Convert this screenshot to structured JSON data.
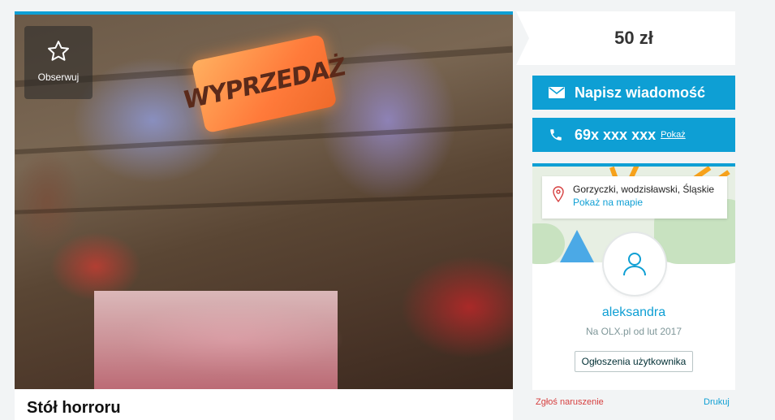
{
  "photo": {
    "sign_text": "WYPRZEDAŻ",
    "observe_label": "Obserwuj",
    "observe_icon": "star-icon"
  },
  "listing": {
    "title": "Stół horroru",
    "price": "50 zł"
  },
  "actions": {
    "message_label": "Napisz wiadomość",
    "message_icon": "envelope-icon",
    "phone_number": "69x xxx xxx",
    "phone_show_label": "Pokaż",
    "phone_icon": "phone-icon"
  },
  "user": {
    "location": "Gorzyczki, wodzisławski, Śląskie",
    "show_on_map": "Pokaż na mapie",
    "name": "aleksandra",
    "since": "Na OLX.pl od lut 2017",
    "user_ads_button": "Ogłoszenia użytkownika"
  },
  "footer": {
    "report": "Zgłoś naruszenie",
    "print": "Drukuj"
  },
  "colors": {
    "accent": "#0e9fd4",
    "map_road": "#f7a21b",
    "report": "#d63f3f"
  }
}
